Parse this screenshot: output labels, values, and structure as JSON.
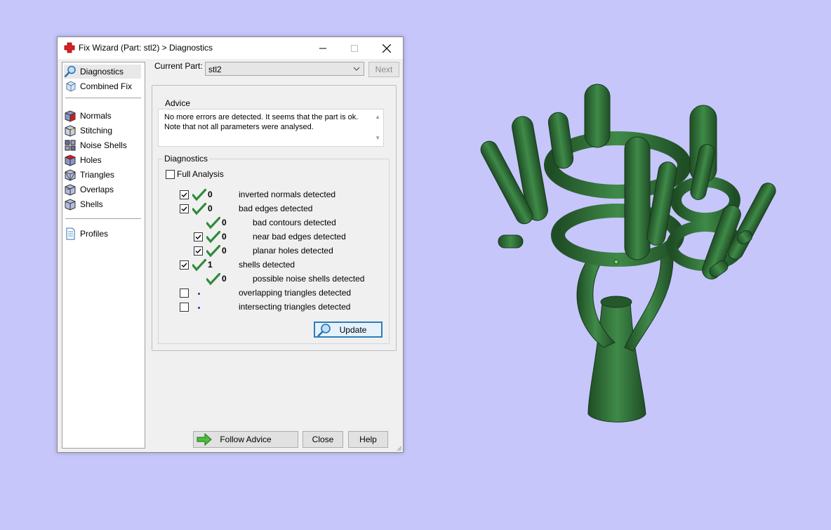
{
  "window": {
    "title": "Fix Wizard (Part: stl2) > Diagnostics",
    "controls": [
      "minimize-icon",
      "maximize-icon",
      "close-icon"
    ]
  },
  "sidebar": {
    "items": [
      {
        "label": "Diagnostics",
        "icon": "magnifier-icon",
        "selected": true
      },
      {
        "label": "Combined Fix",
        "icon": "cube-icon"
      },
      {
        "label": "Normals",
        "icon": "normals-cube-icon"
      },
      {
        "label": "Stitching",
        "icon": "stitching-cube-icon"
      },
      {
        "label": "Noise Shells",
        "icon": "noise-shells-icon"
      },
      {
        "label": "Holes",
        "icon": "holes-cube-icon"
      },
      {
        "label": "Triangles",
        "icon": "triangles-cube-icon"
      },
      {
        "label": "Overlaps",
        "icon": "overlaps-cube-icon"
      },
      {
        "label": "Shells",
        "icon": "shells-cube-icon"
      },
      {
        "label": "Profiles",
        "icon": "document-icon"
      }
    ]
  },
  "header": {
    "current_part_label": "Current Part:",
    "current_part_value": "stl2",
    "next_label": "Next"
  },
  "advice": {
    "title": "Advice",
    "text": "No more errors are detected. It seems that the part is ok. Note that not all parameters were analysed."
  },
  "diagnostics": {
    "title": "Diagnostics",
    "full_analysis_label": "Full Analysis",
    "full_analysis_checked": false,
    "rows": [
      {
        "checked": true,
        "status": "ok",
        "count": "0",
        "label": "inverted normals detected",
        "indent": 0,
        "checkbox": true
      },
      {
        "checked": true,
        "status": "ok",
        "count": "0",
        "label": "bad edges detected",
        "indent": 0,
        "checkbox": true
      },
      {
        "checked": false,
        "status": "ok",
        "count": "0",
        "label": "bad contours detected",
        "indent": 1,
        "checkbox": false
      },
      {
        "checked": true,
        "status": "ok",
        "count": "0",
        "label": "near bad edges detected",
        "indent": 1,
        "checkbox": true
      },
      {
        "checked": true,
        "status": "ok",
        "count": "0",
        "label": "planar holes detected",
        "indent": 1,
        "checkbox": true
      },
      {
        "checked": true,
        "status": "ok",
        "count": "1",
        "label": "shells detected",
        "indent": 0,
        "checkbox": true
      },
      {
        "checked": false,
        "status": "ok",
        "count": "0",
        "label": "possible noise shells detected",
        "indent": 1,
        "checkbox": false
      },
      {
        "checked": false,
        "status": "pending",
        "count": "",
        "label": "overlapping triangles detected",
        "indent": 0,
        "checkbox": true
      },
      {
        "checked": false,
        "status": "pending",
        "count": "",
        "label": "intersecting triangles detected",
        "indent": 0,
        "checkbox": true
      }
    ],
    "update_label": "Update"
  },
  "footer": {
    "follow_advice_label": "Follow Advice",
    "close_label": "Close",
    "help_label": "Help"
  },
  "colors": {
    "desktop_bg": "#c6c6fb",
    "model_green": "#2e6b34",
    "check_green": "#2e8b3a"
  }
}
